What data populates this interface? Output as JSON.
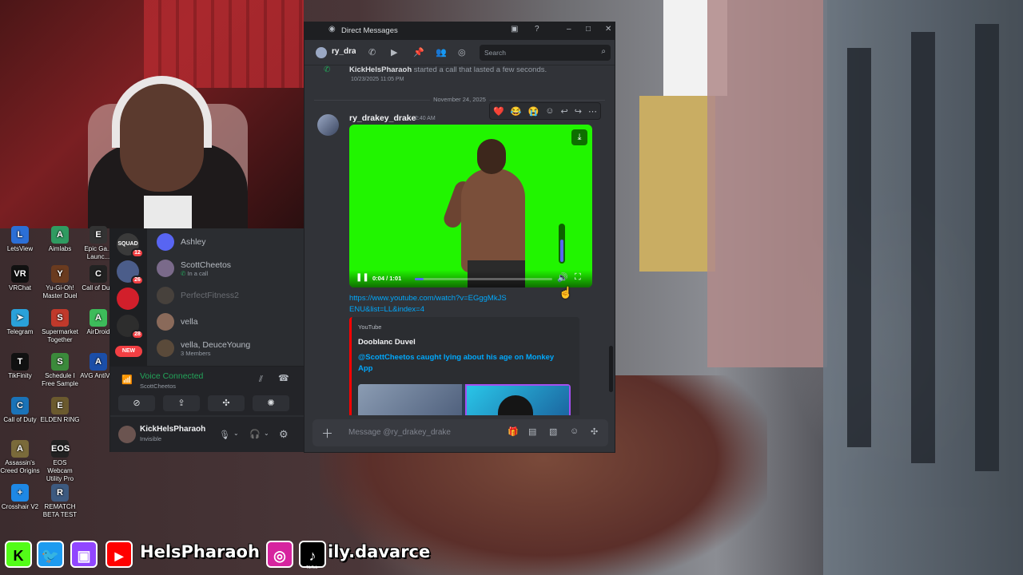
{
  "colors": {
    "discord_bg": "#313338",
    "discord_sidebar": "#2b2d31",
    "voice_green": "#23a55a",
    "link_blue": "#00a8fc",
    "youtube_red": "#ff0000",
    "green_screen": "#21f500",
    "mention_red": "#f23f43"
  },
  "desktop_icons": [
    {
      "label": "LetsView",
      "icon": "letsview-icon",
      "color": "#2b6fd6",
      "glyph": "L"
    },
    {
      "label": "Aimlabs",
      "icon": "aimlabs-icon",
      "color": "#2f9b61",
      "glyph": "A"
    },
    {
      "label": "Epic Ga... Launc...",
      "icon": "epic-games-icon",
      "color": "#333",
      "glyph": "E"
    },
    {
      "label": "VRChat",
      "icon": "vrchat-icon",
      "color": "#111",
      "glyph": "VR"
    },
    {
      "label": "Yu-Gi-Oh! Master Duel",
      "icon": "yugioh-icon",
      "color": "#6a3b1f",
      "glyph": "Y"
    },
    {
      "label": "Call of Duty",
      "icon": "cod-icon",
      "color": "#222",
      "glyph": "C"
    },
    {
      "label": "Telegram",
      "icon": "telegram-icon",
      "color": "#2aa1da",
      "glyph": "➤"
    },
    {
      "label": "Supermarket Together",
      "icon": "supermarket-icon",
      "color": "#c0392b",
      "glyph": "S"
    },
    {
      "label": "AirDroid",
      "icon": "airdroid-icon",
      "color": "#3dbb5a",
      "glyph": "A"
    },
    {
      "label": "TikFinity",
      "icon": "tikfinity-icon",
      "color": "#111",
      "glyph": "T"
    },
    {
      "label": "Schedule I Free Sample",
      "icon": "schedule-icon",
      "color": "#3b8a3b",
      "glyph": "S"
    },
    {
      "label": "AVG AntiVi...",
      "icon": "avg-icon",
      "color": "#1b4ea8",
      "glyph": "A"
    },
    {
      "label": "Call of Duty",
      "icon": "cod-icon",
      "color": "#1a73b8",
      "glyph": "C"
    },
    {
      "label": "ELDEN RING",
      "icon": "elden-ring-icon",
      "color": "#6b5a2e",
      "glyph": "E"
    },
    {
      "label": "Assassin's Creed Origins",
      "icon": "assassins-creed-icon",
      "color": "#7a6a3a",
      "glyph": "A"
    },
    {
      "label": "EOS Webcam Utility Pro",
      "icon": "eos-webcam-icon",
      "color": "#222",
      "glyph": "EOS"
    },
    {
      "label": "Crosshair V2",
      "icon": "crosshair-icon",
      "color": "#1e88e5",
      "glyph": "+"
    },
    {
      "label": "REMATCH BETA TEST",
      "icon": "rematch-icon",
      "color": "#3d5a80",
      "glyph": "R"
    }
  ],
  "servers": [
    {
      "label": "SQUAD",
      "badge": "12",
      "color": "#3a3a3a"
    },
    {
      "label": "",
      "badge": "26",
      "color": "#4b5d8a"
    },
    {
      "label": "",
      "badge": "",
      "color": "#d21f2b"
    },
    {
      "label": "",
      "badge": "28",
      "color": "#2d2d2d"
    }
  ],
  "new_label": "NEW",
  "dms": [
    {
      "name": "Ashley",
      "sub": "",
      "avatar_color": "#5865f2",
      "dim": false
    },
    {
      "name": "ScottCheetos",
      "sub": "In a call",
      "avatar_color": "#7a6a8a",
      "dim": false
    },
    {
      "name": "PerfectFitness2",
      "sub": "",
      "avatar_color": "#6a5a4a",
      "dim": true
    },
    {
      "name": "vella",
      "sub": "",
      "avatar_color": "#8a6a5a",
      "dim": false
    },
    {
      "name": "vella, DeuceYoung",
      "sub": "3 Members",
      "avatar_color": "#5a4a3a",
      "dim": false
    }
  ],
  "voice": {
    "title": "Voice Connected",
    "channel": "ScottCheetos"
  },
  "user": {
    "name": "KickHelsPharaoh",
    "status": "Invisible"
  },
  "window": {
    "title": "Direct Messages",
    "channel": "ry_drakey_drake",
    "search_placeholder": "Search"
  },
  "system_message": {
    "author": "KickHelsPharaoh",
    "text": "started a call that lasted a few seconds.",
    "time": "10/23/2025 11:05 PM"
  },
  "date_divider": "November 24, 2025",
  "message": {
    "author": "ry_drakey_drake",
    "time": "2:40 AM",
    "reactions": [
      "❤️",
      "😂",
      "😭"
    ],
    "video_time": "0:04 / 1:01",
    "video_progress": 0.066,
    "volume_level": 0.6,
    "link": "https://www.youtube.com/watch?v=EGggMkJSENU&list=LL&index=4"
  },
  "embed": {
    "provider": "YouTube",
    "author": "Dooblanc Duvel",
    "title": "@ScottCheetos caught lying about his age on Monkey App"
  },
  "composer": {
    "placeholder": "Message @ry_drakey_drake"
  },
  "social": {
    "handle1": "HelsPharaoh",
    "handle2": "ily.davarce",
    "tiktok_label": "TikTok"
  }
}
